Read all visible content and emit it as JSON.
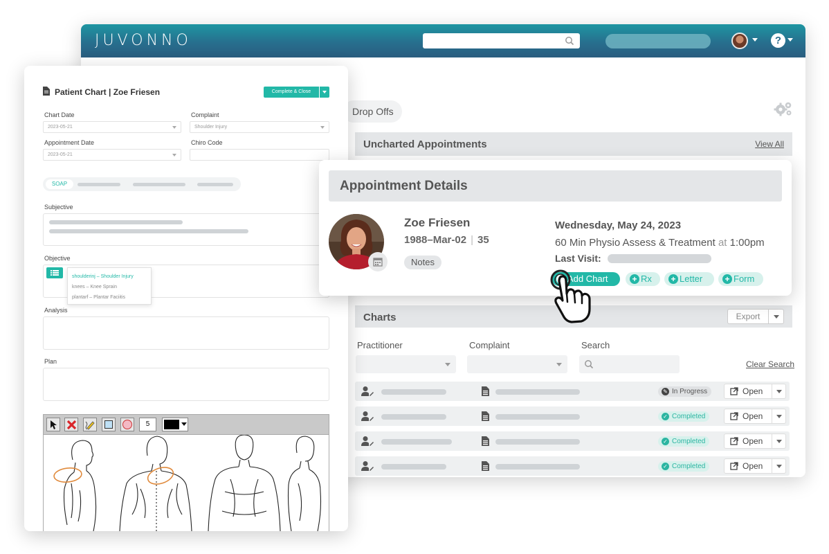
{
  "app": {
    "brand": "JUVONNO"
  },
  "header": {
    "search_placeholder": ""
  },
  "dashboard": {
    "drop_offs_label": "Drop Offs",
    "uncharted": {
      "title": "Uncharted Appointments",
      "view_all": "View All"
    },
    "charts": {
      "title": "Charts",
      "export_label": "Export",
      "filters": {
        "practitioner": "Practitioner",
        "complaint": "Complaint",
        "search": "Search",
        "clear_search": "Clear Search"
      },
      "rows": [
        {
          "status": "In Progress",
          "open": "Open"
        },
        {
          "status": "Completed",
          "open": "Open"
        },
        {
          "status": "Completed",
          "open": "Open"
        },
        {
          "status": "Completed",
          "open": "Open"
        }
      ]
    }
  },
  "appointment": {
    "title": "Appointment Details",
    "patient_name": "Zoe Friesen",
    "dob": "1988–Mar-02",
    "age": "35",
    "notes_label": "Notes",
    "date": "Wednesday, May 24, 2023",
    "service": "60 Min Physio Assess & Treatment",
    "at_word": "at",
    "time": "1:00pm",
    "last_visit_label": "Last Visit:",
    "actions": {
      "add_chart": "Add Chart",
      "rx": "Rx",
      "letter": "Letter",
      "form": "Form"
    }
  },
  "patient_chart": {
    "title": "Patient Chart  |  Zoe Friesen",
    "complete_close": "Complete & Close",
    "fields": {
      "chart_date_label": "Chart Date",
      "chart_date_value": "2023-05-21",
      "complaint_label": "Complaint",
      "complaint_value": "Shoulder Injury",
      "appointment_date_label": "Appointment Date",
      "appointment_date_value": "2023-05-21",
      "chiro_code_label": "Chiro Code",
      "chiro_code_value": ""
    },
    "tab_soap": "SOAP",
    "sections": {
      "subjective": "Subjective",
      "objective": "Objective",
      "analysis": "Analysis",
      "plan": "Plan"
    },
    "dropdown": [
      "shoulderinj – Shoulder Injury",
      "knees – Knee Sprain",
      "plantarf – Plantar Faciitis"
    ],
    "toolbar_size": "5"
  },
  "colors": {
    "accent": "#22b8a7",
    "header_start": "#1e96a2",
    "header_end": "#2a5d7f"
  }
}
